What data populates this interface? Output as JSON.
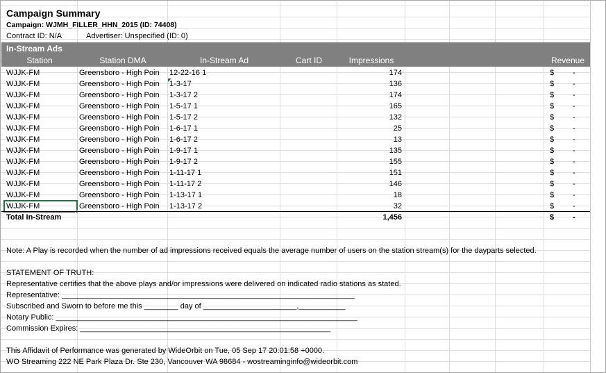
{
  "header": {
    "title": "Campaign Summary",
    "campaign": "Campaign: WJMH_FILLER_HHN_2015 (ID: 74408)",
    "contract": "Contract ID: N/A",
    "advertiser": "Advertiser: Unspecified (ID: 0)"
  },
  "section": {
    "title": "In-Stream Ads",
    "columns": {
      "station": "Station",
      "dma": "Station DMA",
      "ad": "In-Stream Ad",
      "cart": "Cart ID",
      "impressions": "Impressions",
      "revenue": "Revenue"
    }
  },
  "rows": [
    {
      "station": "WJJK-FM",
      "dma": "Greensboro - High Poin",
      "ad": "12-22-16 1",
      "impressions": "174",
      "currency": "$",
      "revenue": "-"
    },
    {
      "station": "WJJK-FM",
      "dma": "Greensboro - High Poin",
      "ad": "1-3-17",
      "impressions": "136",
      "currency": "$",
      "revenue": "-"
    },
    {
      "station": "WJJK-FM",
      "dma": "Greensboro - High Poin",
      "ad": "1-3-17 2",
      "impressions": "174",
      "currency": "$",
      "revenue": "-"
    },
    {
      "station": "WJJK-FM",
      "dma": "Greensboro - High Poin",
      "ad": "1-5-17 1",
      "impressions": "165",
      "currency": "$",
      "revenue": "-"
    },
    {
      "station": "WJJK-FM",
      "dma": "Greensboro - High Poin",
      "ad": "1-5-17 2",
      "impressions": "132",
      "currency": "$",
      "revenue": "-"
    },
    {
      "station": "WJJK-FM",
      "dma": "Greensboro - High Poin",
      "ad": "1-6-17 1",
      "impressions": "25",
      "currency": "$",
      "revenue": "-"
    },
    {
      "station": "WJJK-FM",
      "dma": "Greensboro - High Poin",
      "ad": "1-6-17 2",
      "impressions": "13",
      "currency": "$",
      "revenue": "-"
    },
    {
      "station": "WJJK-FM",
      "dma": "Greensboro - High Poin",
      "ad": "1-9-17 1",
      "impressions": "135",
      "currency": "$",
      "revenue": "-"
    },
    {
      "station": "WJJK-FM",
      "dma": "Greensboro - High Poin",
      "ad": "1-9-17 2",
      "impressions": "155",
      "currency": "$",
      "revenue": "-"
    },
    {
      "station": "WJJK-FM",
      "dma": "Greensboro - High Poin",
      "ad": "1-11-17 1",
      "impressions": "151",
      "currency": "$",
      "revenue": "-"
    },
    {
      "station": "WJJK-FM",
      "dma": "Greensboro - High Poin",
      "ad": "1-11-17 2",
      "impressions": "146",
      "currency": "$",
      "revenue": "-"
    },
    {
      "station": "WJJK-FM",
      "dma": "Greensboro - High Poin",
      "ad": "1-13-17 1",
      "impressions": "18",
      "currency": "$",
      "revenue": "-"
    },
    {
      "station": "WJJK-FM",
      "dma": "Greensboro - High Poin",
      "ad": "1-13-17 2",
      "impressions": "32",
      "currency": "$",
      "revenue": "-"
    }
  ],
  "total": {
    "label": "Total In-Stream",
    "impressions": "1,456",
    "currency": "$",
    "revenue": "-"
  },
  "note": "Note: A Play is recorded when the number of ad impressions received equals the average number of users on the station stream(s) for the dayparts selected.",
  "affidavit": {
    "heading": "STATEMENT OF TRUTH:",
    "line1": "Representative certifies that the above plays and/or impressions were delivered on indicated radio stations as stated.",
    "line2": "Representative: _____________________________________________________________________",
    "line3": "Subscribed and Sworn to before me this ________ day of ______________________,___________",
    "line4": "Notary Public: _______________________________________________________________________",
    "line5": "Commission Expires: ___________________________________________________________"
  },
  "footer": {
    "generated": "This Affidavit of Performance was generated by WideOrbit on Tue, 05 Sep 17 20:01:58 +0000.",
    "address": "WO Streaming 222 NE Park Plaza Dr. Ste 230, Vancouver WA 98684 - wostreaminginfo@wideorbit.com"
  },
  "colors": {
    "band": "#808080",
    "selection": "#217346",
    "gridline": "#dcdcdc"
  }
}
